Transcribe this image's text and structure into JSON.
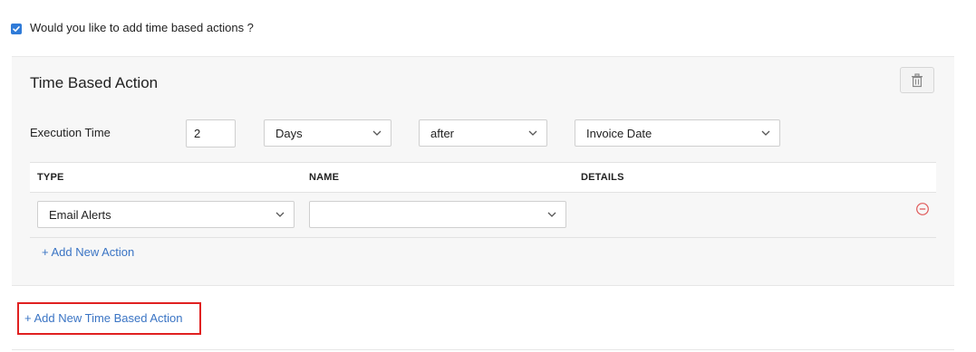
{
  "question": {
    "label": "Would you like to add time based actions ?",
    "checked": true
  },
  "panel": {
    "title": "Time Based Action",
    "execution": {
      "label": "Execution Time",
      "amount": "2",
      "unit": "Days",
      "relation": "after",
      "reference": "Invoice Date"
    },
    "table": {
      "columns": [
        "TYPE",
        "NAME",
        "DETAILS"
      ],
      "rows": [
        {
          "type": "Email Alerts",
          "name": ""
        }
      ]
    },
    "add_action_label": "+ Add New Action"
  },
  "add_time_based_action_label": "+ Add New Time Based Action",
  "colors": {
    "accent_link": "#3a74c4",
    "checkbox": "#2f7bd8",
    "highlight": "#e02020",
    "remove_icon": "#e05a5a"
  },
  "icons": [
    "check-icon",
    "trash-icon",
    "chevron-down-icon",
    "remove-circle-icon"
  ]
}
